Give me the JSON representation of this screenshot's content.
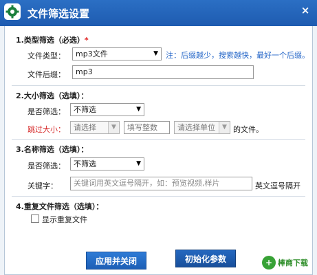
{
  "window": {
    "title": "文件筛选设置",
    "close_label": "×",
    "app_icon": "gear-icon"
  },
  "type_section": {
    "title": "1.类型筛选（必选）",
    "required_mark": "*",
    "file_type_label": "文件类型：",
    "file_type_value": "mp3文件",
    "hint": "注：后缀越少，搜索越快，最好一个后缀。",
    "suffix_label": "文件后缀：",
    "suffix_value": "mp3"
  },
  "size_section": {
    "title": "2.大小筛选（选填）：",
    "filter_label": "是否筛选：",
    "filter_value": "不筛选",
    "skip_label": "跳过大小：",
    "compare_placeholder": "请选择",
    "number_placeholder": "填写整数",
    "unit_placeholder": "请选择单位",
    "file_suffix_text": "的文件。"
  },
  "name_section": {
    "title": "3.名称筛选（选填）：",
    "filter_label": "是否筛选：",
    "filter_value": "不筛选",
    "keyword_label": "关键字：",
    "keyword_placeholder": "关键词用英文逗号隔开，如：预览视频,样片",
    "keyword_note": "英文逗号隔开"
  },
  "dup_section": {
    "title": "4.重复文件筛选（选填）：",
    "show_dup_label": "显示重复文件",
    "show_dup_checked": false
  },
  "buttons": {
    "apply": "应用并关闭",
    "reset": "初始化参数"
  },
  "watermark": {
    "mark": "+",
    "text": "棒商下载"
  },
  "colors": {
    "titlebar": "#1e5bb0",
    "hint": "#2063c7",
    "warning": "#d72c2c",
    "button": "#1d5fb6"
  }
}
